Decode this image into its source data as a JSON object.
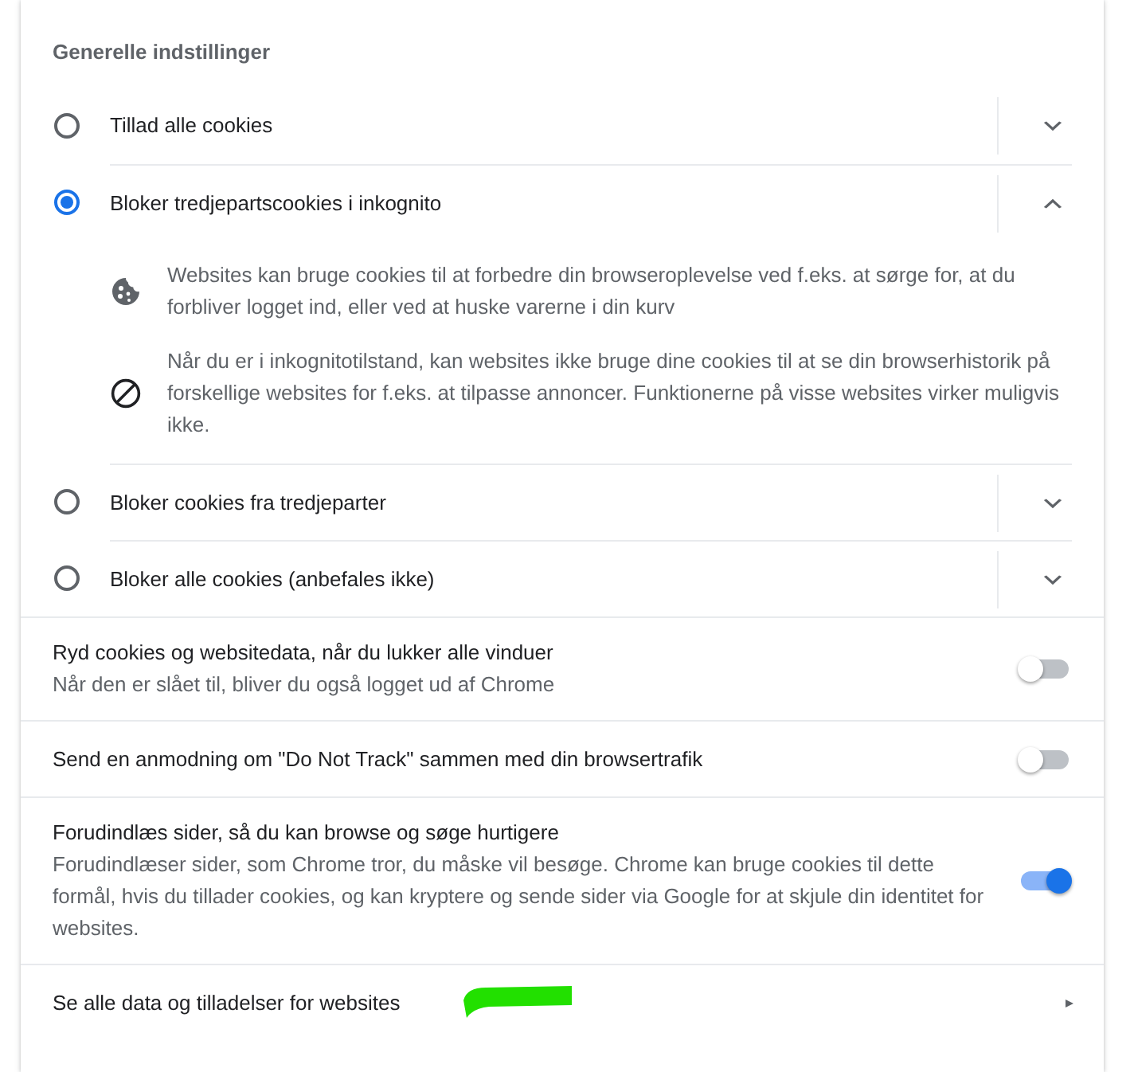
{
  "section_title": "Generelle indstillinger",
  "cookie_options": [
    {
      "label": "Tillad alle cookies",
      "selected": false,
      "expanded": false
    },
    {
      "label": "Bloker tredjepartscookies i inkognito",
      "selected": true,
      "expanded": true,
      "details": [
        {
          "kind": "cookie",
          "text": "Websites kan bruge cookies til at forbedre din browseroplevelse ved f.eks. at sørge for, at du forbliver logget ind, eller ved at huske varerne i din kurv"
        },
        {
          "kind": "block",
          "text": "Når du er i inkognitotilstand, kan websites ikke bruge dine cookies til at se din browserhistorik på forskellige websites for f.eks. at tilpasse annoncer. Funktionerne på visse websites virker muligvis ikke."
        }
      ]
    },
    {
      "label": "Bloker cookies fra tredjeparter",
      "selected": false,
      "expanded": false
    },
    {
      "label": "Bloker alle cookies (anbefales ikke)",
      "selected": false,
      "expanded": false
    }
  ],
  "toggles": [
    {
      "title": "Ryd cookies og websitedata, når du lukker alle vinduer",
      "description": "Når den er slået til, bliver du også logget ud af Chrome",
      "on": false
    },
    {
      "title": "Send en anmodning om \"Do Not Track\" sammen med din browsertrafik",
      "on": false
    },
    {
      "title": "Forudindlæs sider, så du kan browse og søge hurtigere",
      "description": "Forudindlæser sider, som Chrome tror, du måske vil besøge. Chrome kan bruge cookies til dette formål, hvis du tillader cookies, og kan kryptere og sende sider via Google for at skjule din identitet for websites.",
      "on": true
    }
  ],
  "link_row": {
    "label": "Se alle data og tilladelser for websites",
    "highlighted": true
  }
}
